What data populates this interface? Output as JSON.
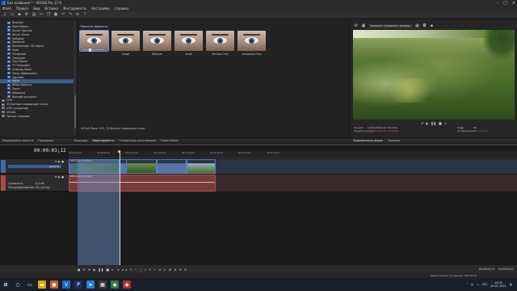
{
  "window": {
    "title": "Без названия * - VEGAS Pro 17.0"
  },
  "menu": [
    "Файл",
    "Правка",
    "Вид",
    "Вставка",
    "Инструменты",
    "Настройки",
    "Справка"
  ],
  "effects_tree": [
    {
      "label": "Sharpen",
      "kind": "fx"
    },
    {
      "label": "Slow Motion",
      "kind": "fx"
    },
    {
      "label": "Smart Upscale",
      "kind": "fx"
    },
    {
      "label": "Smart Zoom",
      "kind": "fx"
    },
    {
      "label": "Softglow",
      "kind": "fx"
    },
    {
      "label": "Starburst",
      "kind": "fx"
    },
    {
      "label": "Stereoscopic 3D Adjust",
      "kind": "fx"
    },
    {
      "label": "Swirl",
      "kind": "fx"
    },
    {
      "label": "Threshold",
      "kind": "fx"
    },
    {
      "label": "Timecode",
      "kind": "fx"
    },
    {
      "label": "Tiny Planet",
      "kind": "fx"
    },
    {
      "label": "TV Simulator",
      "kind": "fx"
    },
    {
      "label": "Unsharp Mask",
      "kind": "fx"
    },
    {
      "label": "Video Stabilization",
      "kind": "fx"
    },
    {
      "label": "Vignette",
      "kind": "fx"
    },
    {
      "label": "Wave",
      "kind": "fx",
      "selected": true
    },
    {
      "label": "White Balance",
      "kind": "fx"
    },
    {
      "label": "Zoom",
      "kind": "fx"
    },
    {
      "label": "Медиана",
      "kind": "fx"
    },
    {
      "label": "Мягкий контраст",
      "kind": "fx"
    },
    {
      "label": "OFX",
      "kind": "cat"
    },
    {
      "label": "32-битная плавающая точка",
      "kind": "cat"
    },
    {
      "label": "GPU ускорение",
      "kind": "cat"
    },
    {
      "label": "VEGAS",
      "kind": "cat"
    },
    {
      "label": "Третьи стороны",
      "kind": "cat"
    }
  ],
  "presets": {
    "heading": "Пресеты эффекта",
    "items": [
      {
        "label": ""
      },
      {
        "label": "Large"
      },
      {
        "label": "Medium"
      },
      {
        "label": "Small"
      },
      {
        "label": "Vertical Only"
      },
      {
        "label": "Horizontal Only"
      }
    ],
    "description": "VEGAS Wave: OFX, 32-битная плавающая точка"
  },
  "left_tabs": [
    "Медиафайлы проекта",
    "Проводник"
  ],
  "middle_tabs": [
    "Переходы",
    "Видеоэффекты",
    "Генераторы мультимедиа",
    "Project Notes"
  ],
  "preview": {
    "quality": "Хорошее (сохранять размер)",
    "info": {
      "project_label": "Проект:",
      "project_val": "1920x1080x32; 29,970p",
      "preview_label": "Предпросмотр:",
      "preview_val": "960x540x32; 29,970p",
      "display_label": "Отображение:",
      "display_val": "480x270x32",
      "frame_label": "Кадр:",
      "frame_val": "95"
    },
    "tabs": [
      "Предпросмотр видео",
      "Триммер"
    ]
  },
  "timeline": {
    "timecode": "00:00:03;12",
    "ruler": [
      "00:00:00;00",
      "00:00:02;00",
      "00:00:04;00",
      "00:00:06;00",
      "00:00:08;00",
      "00:00:10;00",
      "00:00:12;00",
      "00:00:14;00"
    ],
    "video_track": {
      "num": "1",
      "level_label": "Уровень:",
      "level_val": "100,0 %"
    },
    "audio_track": {
      "num": "2",
      "vol_label": "Громкость:",
      "vol_val": "0,0 dB",
      "pan_label": "Панорамирование:",
      "pan_val": "По центру"
    },
    "clip_name": "DHI (1)-RO_stabilized",
    "rate": "Частота: 0,00",
    "end_tc": "00:00:03;12",
    "len_tc": "00:00:03;12"
  },
  "status": {
    "text": "Время записи (2 канала): 397:55:15"
  },
  "tray": {
    "lang": "РУС",
    "time": "14:25",
    "date": "05.01.2021"
  }
}
